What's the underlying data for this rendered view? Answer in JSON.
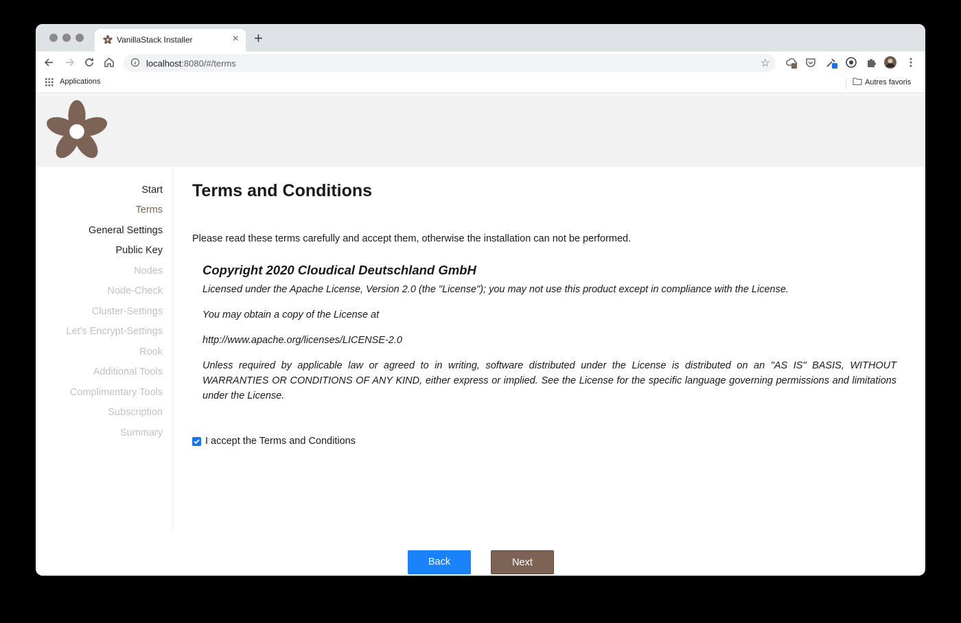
{
  "browser": {
    "tab_title": "VanillaStack Installer",
    "tab_close": "×",
    "new_tab": "+",
    "url_host": "localhost",
    "url_rest": ":8080/#/terms",
    "bookmark_apps": "Applications",
    "bookmark_other": "Autres favoris"
  },
  "sidebar": {
    "steps": [
      {
        "label": "Start",
        "state": "done"
      },
      {
        "label": "Terms",
        "state": "active"
      },
      {
        "label": "General Settings",
        "state": "done"
      },
      {
        "label": "Public Key",
        "state": "done"
      },
      {
        "label": "Nodes",
        "state": "disabled"
      },
      {
        "label": "Node-Check",
        "state": "disabled"
      },
      {
        "label": "Cluster-Settings",
        "state": "disabled"
      },
      {
        "label": "Let's Encrypt-Settings",
        "state": "disabled"
      },
      {
        "label": "Rook",
        "state": "disabled"
      },
      {
        "label": "Additional Tools",
        "state": "disabled"
      },
      {
        "label": "Complimentary Tools",
        "state": "disabled"
      },
      {
        "label": "Subscription",
        "state": "disabled"
      },
      {
        "label": "Summary",
        "state": "disabled"
      }
    ]
  },
  "main": {
    "title": "Terms and Conditions",
    "intro": "Please read these terms carefully and accept them, otherwise the installation can not be performed.",
    "license_heading": "Copyright 2020 Cloudical Deutschland GmbH",
    "license_paragraphs": [
      "Licensed under the Apache License, Version 2.0 (the \"License\"); you may not use this product except in compliance with the License.",
      "You may obtain a copy of the License at",
      "http://www.apache.org/licenses/LICENSE-2.0",
      "Unless required by applicable law or agreed to in writing, software distributed under the License is distributed on an \"AS IS\" BASIS, WITHOUT WARRANTIES OR CONDITIONS OF ANY KIND, either express or implied. See the License for the specific language governing permissions and limitations under the License."
    ],
    "accept_label": "I accept the Terms and Conditions",
    "accept_checked": true
  },
  "buttons": {
    "back": "Back",
    "next": "Next"
  },
  "colors": {
    "brand": "#7d6356",
    "primary": "#1a82fb"
  },
  "icons": [
    "flower-logo-icon",
    "back-arrow-icon",
    "forward-arrow-icon",
    "reload-icon",
    "home-icon",
    "info-icon",
    "star-icon",
    "apps-grid-icon",
    "folder-icon",
    "extension-icon",
    "profile-avatar",
    "menu-dots-icon"
  ]
}
